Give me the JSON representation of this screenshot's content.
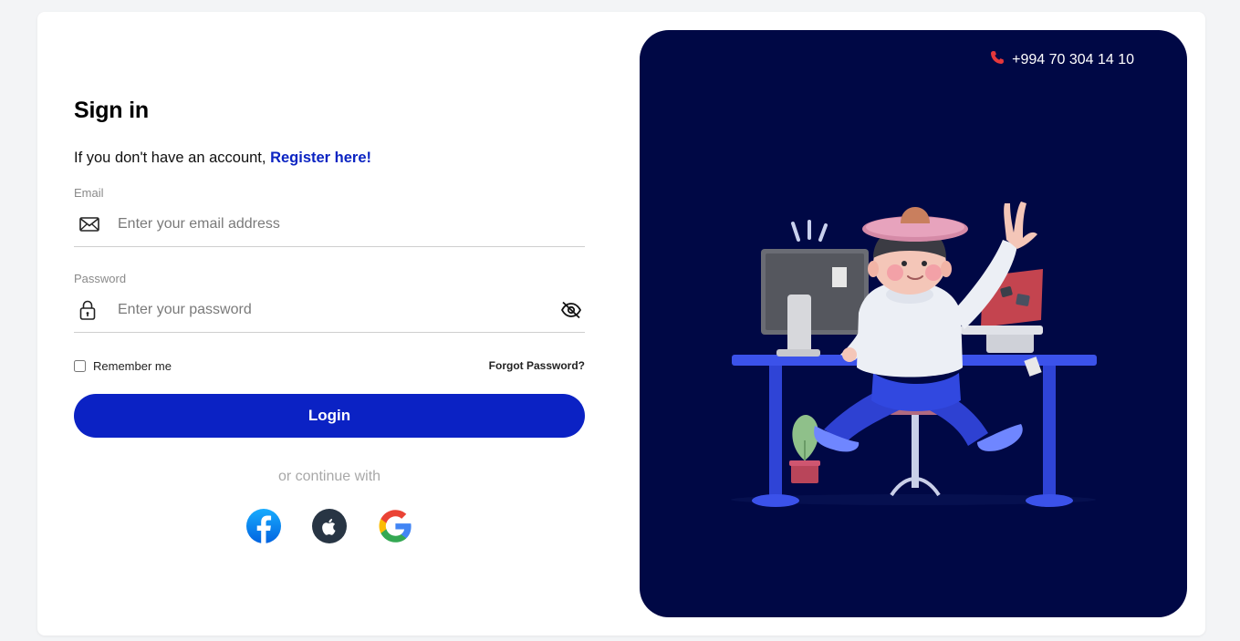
{
  "signin": {
    "title": "Sign in",
    "subtitle_prefix": "If you don't have an account, ",
    "register_link": "Register here!",
    "email": {
      "label": "Email",
      "placeholder": "Enter your email address",
      "value": ""
    },
    "password": {
      "label": "Password",
      "placeholder": "Enter your password",
      "value": ""
    },
    "remember_label": "Remember me",
    "remember_checked": false,
    "forgot_label": "Forgot Password?",
    "login_label": "Login",
    "or_text": "or continue with",
    "social_icons": [
      "facebook-icon",
      "apple-icon",
      "google-icon"
    ]
  },
  "contact": {
    "phone_icon": "phone-icon",
    "phone": "+994 70 304 14 10"
  },
  "colors": {
    "accent": "#0b22c4",
    "link": "#0b24c2",
    "panel": "#000845",
    "phone_icon": "#e5383b"
  }
}
